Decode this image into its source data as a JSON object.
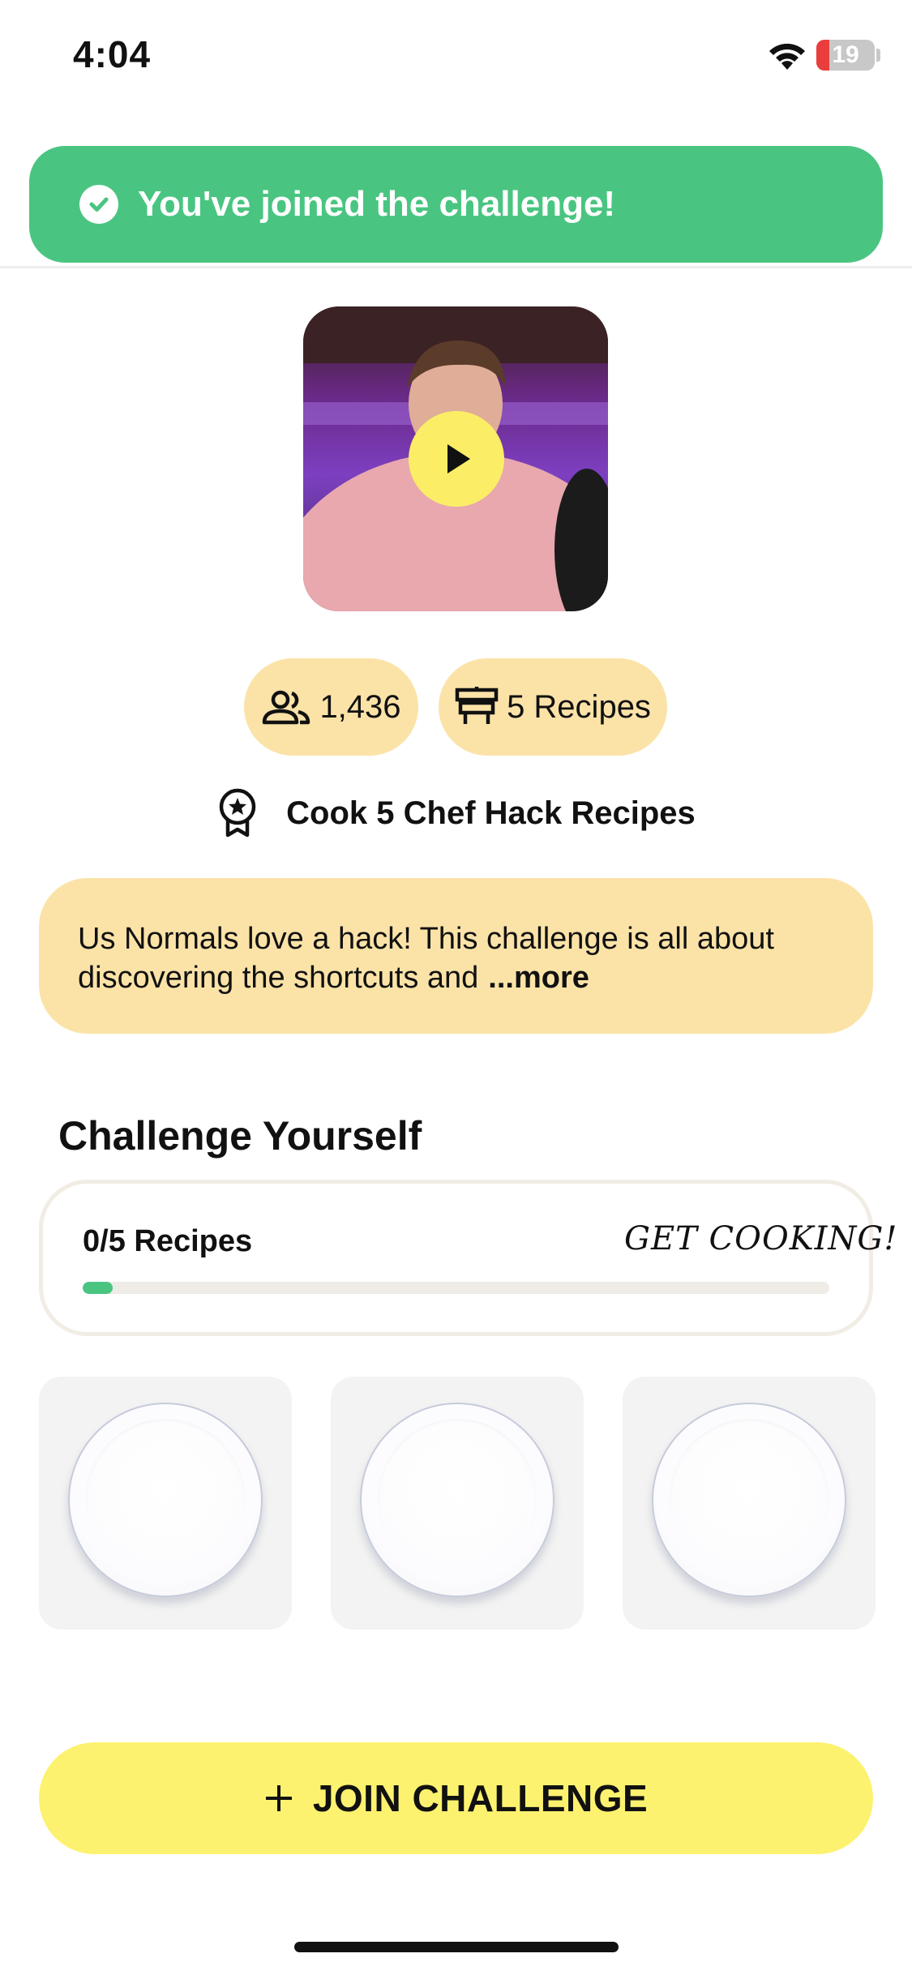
{
  "status_bar": {
    "time": "4:04",
    "battery_level": "19",
    "battery_color": "#ea3d3d"
  },
  "toast": {
    "message": "You've joined the challenge!",
    "color": "#4ac581",
    "icon": "check-circle-icon"
  },
  "video": {
    "thumbnail": "chef-portrait",
    "play_icon": "play-icon",
    "play_color": "#fbee66"
  },
  "stats": {
    "members": {
      "value": "1,436",
      "icon": "people-icon"
    },
    "recipes": {
      "value": "5 Recipes",
      "icon": "chef-hat-icon"
    }
  },
  "goal": {
    "text": "Cook 5 Chef Hack Recipes",
    "icon": "award-badge-icon"
  },
  "description": {
    "text": "Us Normals love a hack! This challenge is all about discovering the shortcuts and",
    "more_label": "...more"
  },
  "challenge_section": {
    "title": "Challenge Yourself",
    "progress_label": "0/5 Recipes",
    "cta": "GET COOKING!",
    "progress_fraction": 0.04
  },
  "plates": [
    {
      "icon": "empty-plate-icon"
    },
    {
      "icon": "empty-plate-icon"
    },
    {
      "icon": "empty-plate-icon"
    }
  ],
  "join_button": {
    "label": "JOIN CHALLENGE",
    "icon": "plus-icon",
    "color": "#fdf26f"
  }
}
